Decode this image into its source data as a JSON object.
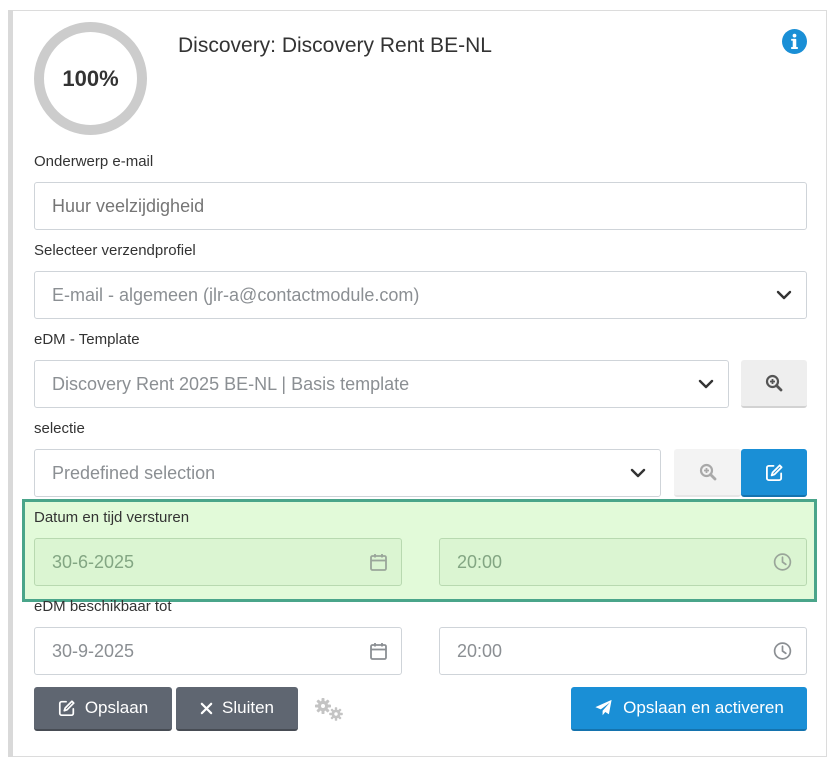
{
  "header": {
    "progress": "100%",
    "title": "Discovery: Discovery Rent BE-NL",
    "info_icon": "info-circle-icon"
  },
  "form": {
    "subject": {
      "label": "Onderwerp e-mail",
      "placeholder": "Huur veelzijdigheid"
    },
    "profile": {
      "label": "Selecteer verzendprofiel",
      "value": "E-mail - algemeen (jlr-a@contactmodule.com)"
    },
    "template": {
      "label": "eDM - Template",
      "value": "Discovery Rent 2025 BE-NL | Basis template"
    },
    "selection": {
      "label": "selectie",
      "value": "Predefined selection"
    },
    "send": {
      "label": "Datum en tijd versturen",
      "date": "30-6-2025",
      "time": "20:00"
    },
    "available": {
      "label": "eDM beschikbaar tot",
      "date": "30-9-2025",
      "time": "20:00"
    }
  },
  "actions": {
    "save": "Opslaan",
    "close": "Sluiten",
    "save_activate": "Opslaan en activeren"
  },
  "colors": {
    "primary": "#1a8fd6",
    "dark_button": "#5f6671",
    "highlight_bg": "#e2fad9",
    "highlight_border": "#4aa58a"
  }
}
